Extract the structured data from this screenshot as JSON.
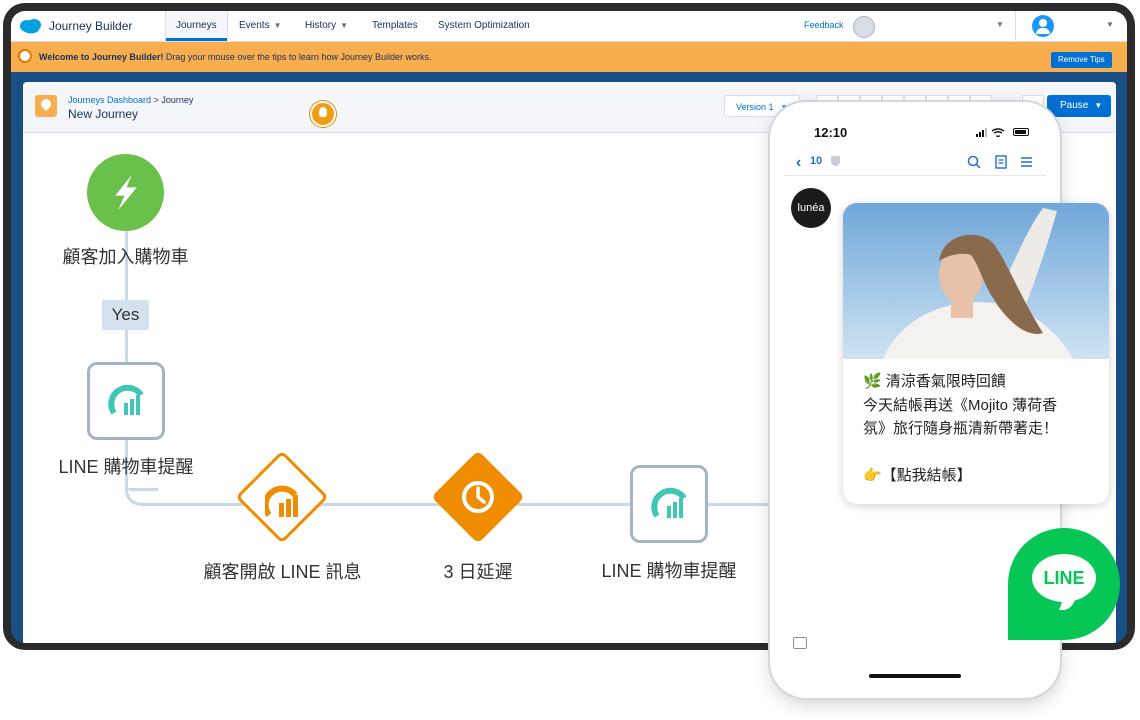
{
  "app": {
    "title": "Journey Builder"
  },
  "nav": {
    "tabs": [
      {
        "label": "Journeys",
        "active": true
      },
      {
        "label": "Events",
        "has_dropdown": true
      },
      {
        "label": "History",
        "has_dropdown": true
      },
      {
        "label": "Templates"
      },
      {
        "label": "System Optimization"
      }
    ],
    "feedback": "Feedback"
  },
  "tipbar": {
    "bold": "Welcome to Journey Builder!",
    "text": " Drag your mouse over the tips to learn how Journey Builder works.",
    "remove_label": "Remove Tips",
    "color": "#f8ad4f"
  },
  "header": {
    "breadcrumb_link": "Journeys Dashboard",
    "breadcrumb_sep": " > ",
    "breadcrumb_current": "Journey",
    "journey_name": "New Journey",
    "version_label": "Version 1",
    "pause_label": "Pause"
  },
  "flow": {
    "entry_label": "顧客加入購物車",
    "yes_label": "Yes",
    "line_node_1": "LINE 購物車提醒",
    "decision_label": "顧客開啟 LINE 訊息",
    "wait_label": "3 日延遲",
    "line_node_2": "LINE 購物車提醒",
    "colors": {
      "entry": "#6bc04b",
      "decision": "#f08c00",
      "connector": "#c9d9e8",
      "line_icon": "#3ec7b4"
    }
  },
  "phone": {
    "time": "12:10",
    "back_count": "10",
    "brand": "lunéa",
    "message_lines": [
      "🌿 清涼香氣限時回饋",
      "今天結帳再送《Mojito 薄荷香",
      "氛》旅行隨身瓶清新帶著走！",
      "",
      "👉【點我結帳】"
    ]
  },
  "line_badge": {
    "text": "LINE",
    "color": "#06c755"
  }
}
